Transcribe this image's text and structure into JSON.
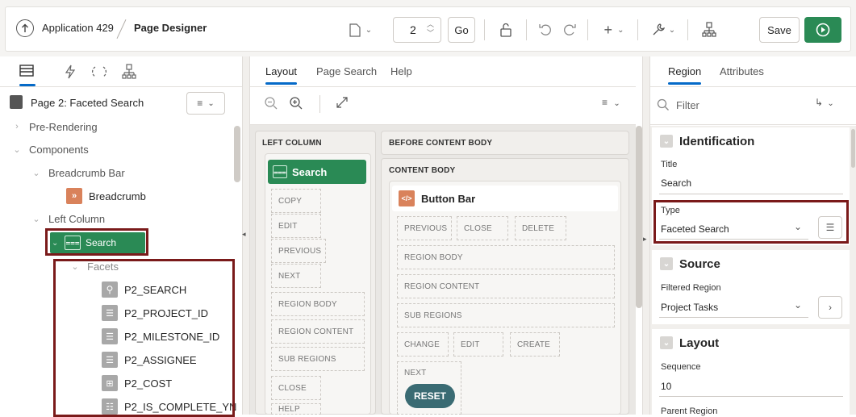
{
  "header": {
    "app_label": "Application 429",
    "page_designer_label": "Page Designer",
    "page_number": "2",
    "go_label": "Go",
    "save_label": "Save"
  },
  "left_panel": {
    "page_title": "Page 2: Faceted Search",
    "tree": {
      "pre_rendering": "Pre-Rendering",
      "components": "Components",
      "breadcrumb_bar": "Breadcrumb Bar",
      "breadcrumb": "Breadcrumb",
      "left_column": "Left Column",
      "search": "Search",
      "facets": "Facets",
      "facet_items": [
        "P2_SEARCH",
        "P2_PROJECT_ID",
        "P2_MILESTONE_ID",
        "P2_ASSIGNEE",
        "P2_COST",
        "P2_IS_COMPLETE_YN"
      ]
    }
  },
  "center_panel": {
    "tabs": [
      "Layout",
      "Page Search",
      "Help"
    ],
    "left_column_title": "LEFT COLUMN",
    "search_region": "Search",
    "left_slots": [
      "COPY",
      "EDIT",
      "PREVIOUS",
      "NEXT",
      "REGION BODY",
      "REGION CONTENT",
      "SUB REGIONS",
      "CLOSE",
      "HELP"
    ],
    "before_content_body": "BEFORE CONTENT BODY",
    "content_body": "CONTENT BODY",
    "button_bar": "Button Bar",
    "bb_buttons": [
      "PREVIOUS",
      "CLOSE",
      "DELETE"
    ],
    "bb_slots": [
      "REGION BODY",
      "REGION CONTENT",
      "SUB REGIONS"
    ],
    "bb_bottom": [
      "CHANGE",
      "EDIT",
      "CREATE"
    ],
    "next_label": "NEXT",
    "reset_label": "RESET"
  },
  "right_panel": {
    "tabs": [
      "Region",
      "Attributes"
    ],
    "filter_placeholder": "Filter",
    "identification": {
      "heading": "Identification",
      "title_label": "Title",
      "title_value": "Search",
      "type_label": "Type",
      "type_value": "Faceted Search"
    },
    "source": {
      "heading": "Source",
      "filtered_region_label": "Filtered Region",
      "filtered_region_value": "Project Tasks"
    },
    "layout": {
      "heading": "Layout",
      "sequence_label": "Sequence",
      "sequence_value": "10",
      "parent_region_label": "Parent Region"
    }
  },
  "colors": {
    "accent_green": "#2a8a55",
    "highlight_border": "#7a1a1a",
    "tab_underline": "#056ac8"
  }
}
